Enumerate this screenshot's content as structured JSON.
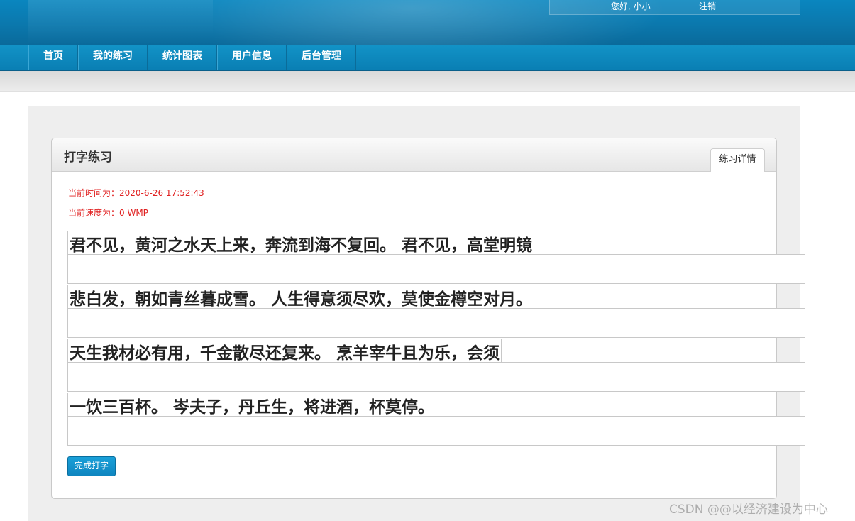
{
  "header": {
    "greeting": "您好, 小小",
    "logout_label": "注销"
  },
  "nav": {
    "items": [
      {
        "label": "首页"
      },
      {
        "label": "我的练习"
      },
      {
        "label": "统计图表"
      },
      {
        "label": "用户信息"
      },
      {
        "label": "后台管理"
      }
    ]
  },
  "panel": {
    "title": "打字练习",
    "tab_label": "练习详情",
    "current_time": "当前时间为：2020-6-26 17:52:43",
    "current_speed": "当前速度为：0 WMP",
    "lines": [
      {
        "text": "君不见，黄河之水天上来，奔流到海不复回。 君不见，高堂明镜",
        "input_value": ""
      },
      {
        "text": "悲白发，朝如青丝暮成雪。 人生得意须尽欢，莫使金樽空对月。",
        "input_value": ""
      },
      {
        "text": "天生我材必有用，千金散尽还复来。 烹羊宰牛且为乐，会须",
        "input_value": ""
      },
      {
        "text": "一饮三百杯。 岑夫子，丹丘生，将进酒，杯莫停。",
        "input_value": ""
      }
    ],
    "done_button_label": "完成打字"
  },
  "watermark": "CSDN @@以经济建设为中心",
  "colors": {
    "header_blue": "#0b78ad",
    "nav_blue": "#0a7fb4",
    "info_red": "#e02020",
    "button_blue": "#1293cc"
  }
}
